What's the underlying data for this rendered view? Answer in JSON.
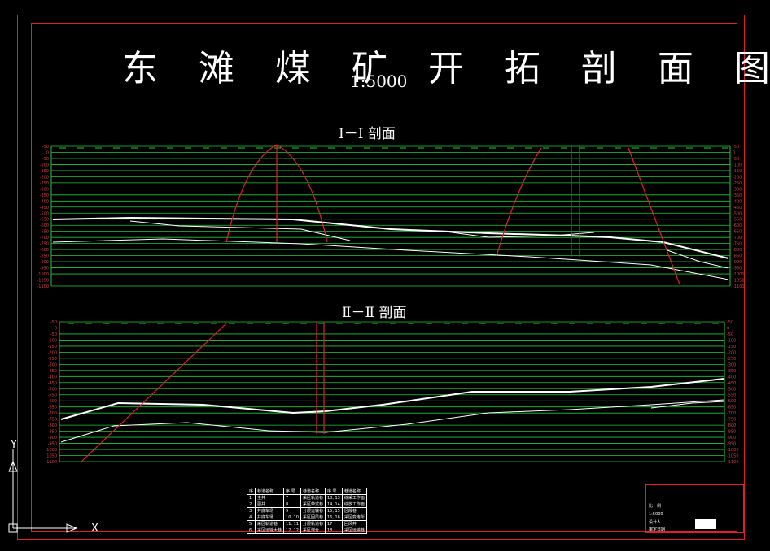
{
  "title": "东 滩 煤 矿 开 拓 剖 面 图",
  "scale": "1:5000",
  "section1": {
    "title": "Ⅰ－Ⅰ 剖面",
    "ticks": [
      "-50",
      "0",
      "-50",
      "-100",
      "-150",
      "-200",
      "-250",
      "-300",
      "-350",
      "-400",
      "-450",
      "-500",
      "-550",
      "-600",
      "-650",
      "-700",
      "-750",
      "-800",
      "-850",
      "-900",
      "-950",
      "-1000",
      "-1050",
      "-1100"
    ]
  },
  "section2": {
    "title": "Ⅱ－Ⅱ 剖面",
    "ticks": [
      "-50",
      "0",
      "-50",
      "-100",
      "-150",
      "-200",
      "-250",
      "-300",
      "-350",
      "-400",
      "-450",
      "-500",
      "-550",
      "-600",
      "-650",
      "-700",
      "-750",
      "-800",
      "-850",
      "-900",
      "-950",
      "-1000",
      "-1050",
      "-1100"
    ]
  },
  "legend": {
    "headers": [
      "序",
      "巷道名称",
      "序 号",
      "巷道名称",
      "序 号",
      "巷道名称"
    ],
    "rows": [
      [
        "1",
        "主井",
        "7",
        "采区轨道巷",
        "13, 13",
        "综采工作面"
      ],
      [
        "2",
        "副井",
        "8",
        "采区带式巷",
        "14, 14",
        "综放工作面"
      ],
      [
        "3",
        "井底车场",
        "9",
        "分层运输巷",
        "15, 15",
        "区段巷"
      ],
      [
        "4",
        "井底车场",
        "10, 10",
        "采区回风巷",
        "16, 16",
        "采区变电所"
      ],
      [
        "5",
        "采区轨道巷",
        "11, 11",
        "分层轨道巷",
        "17",
        "回风井"
      ],
      [
        "6",
        "采区运输大巷",
        "12, 12",
        "采区煤仓",
        "18",
        "采区运输巷"
      ]
    ]
  },
  "titleblock": {
    "header": "比　例",
    "scale": "1:5000",
    "row2": "设计人",
    "row3": "审定日期"
  },
  "colors": {
    "frame": "#e0202a",
    "grid": "#22c83c",
    "line": "#ffffff",
    "shaft": "#e0202a"
  }
}
